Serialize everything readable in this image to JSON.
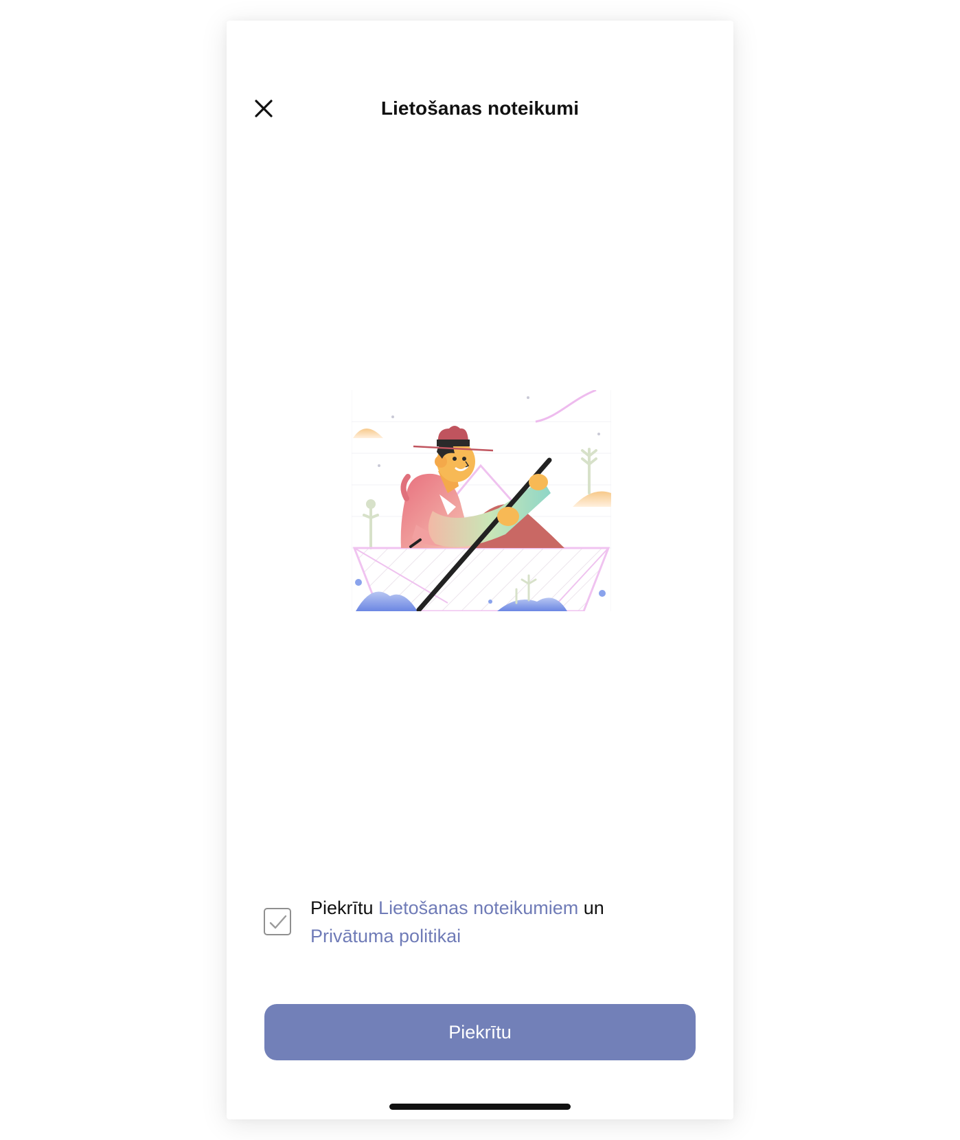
{
  "header": {
    "title": "Lietošanas noteikumi",
    "close_icon": "close-icon"
  },
  "illustration": {
    "description_icon": "man-rowing-boat-illustration"
  },
  "consent": {
    "checked": true,
    "prefix": "Piekrītu ",
    "terms_link": "Lietošanas noteikumiem",
    "middle": " un",
    "privacy_link": "Privātuma politikai"
  },
  "primary_button": {
    "label": "Piekrītu"
  },
  "colors": {
    "accent": "#7280b8",
    "link": "#6f7bb7"
  }
}
